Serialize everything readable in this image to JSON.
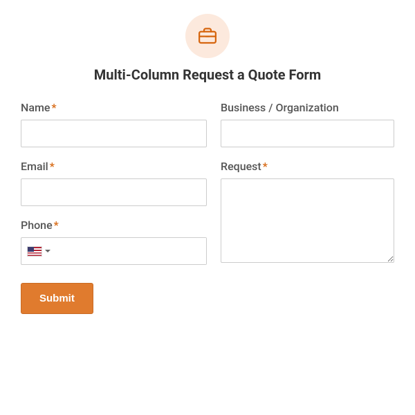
{
  "header": {
    "icon": "briefcase-icon",
    "title": "Multi-Column Request a Quote Form"
  },
  "fields": {
    "name": {
      "label": "Name",
      "required": true,
      "value": ""
    },
    "business": {
      "label": "Business / Organization",
      "required": false,
      "value": ""
    },
    "email": {
      "label": "Email",
      "required": true,
      "value": ""
    },
    "request": {
      "label": "Request",
      "required": true,
      "value": ""
    },
    "phone": {
      "label": "Phone",
      "required": true,
      "value": "",
      "country": "us"
    }
  },
  "required_marker": "*",
  "submit_label": "Submit",
  "colors": {
    "accent": "#e07b2e",
    "required": "#d6660f"
  }
}
